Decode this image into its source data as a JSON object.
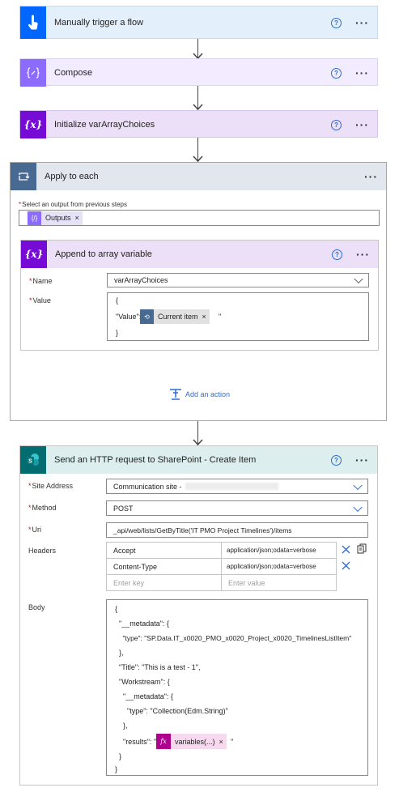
{
  "steps": {
    "trigger": {
      "title": "Manually trigger a flow"
    },
    "compose": {
      "title": "Compose"
    },
    "init_var": {
      "title": "Initialize varArrayChoices",
      "icon_text": "{x}"
    },
    "apply_each": {
      "title": "Apply to each",
      "select_label": "Select an output from previous steps",
      "token": "Outputs",
      "inner": {
        "title": "Append to array variable",
        "icon_text": "{x}",
        "name_label": "Name",
        "name_value": "varArrayChoices",
        "value_label": "Value",
        "value_lines": [
          "{",
          "\"Value\": \"",
          "}"
        ],
        "value_token": "Current item",
        "value_suffix": "\""
      },
      "add_action": "Add an action"
    },
    "http": {
      "title": "Send an HTTP request to SharePoint - Create Item",
      "site_label": "Site Address",
      "site_value": "Communication site -",
      "method_label": "Method",
      "method_value": "POST",
      "uri_label": "Uri",
      "uri_value": "_api/web/lists/GetByTitle('IT PMO Project Timelines')/items",
      "headers_label": "Headers",
      "headers": [
        {
          "key": "Accept",
          "value": "application/json;odata=verbose"
        },
        {
          "key": "Content-Type",
          "value": "application/json;odata=verbose"
        }
      ],
      "key_placeholder": "Enter key",
      "value_placeholder": "Enter value",
      "body_label": "Body",
      "body_lines": [
        "{",
        "  \"__metadata\": {",
        "    \"type\": \"SP.Data.IT_x0020_PMO_x0020_Project_x0020_TimelinesListItem\"",
        "  },",
        "  \"Title\": \"This is a test - 1\",",
        "  \"Workstream\": {",
        "    \"__metadata\": {",
        "      \"type\": \"Collection(Edm.String)\"",
        "    },",
        "    \"results\": \"",
        "  }",
        "}"
      ],
      "body_token": "variables(...)",
      "body_suffix": "\"",
      "fx_text": "fx"
    }
  },
  "common": {
    "help": "?",
    "more": "···",
    "required": "*",
    "remove": "×"
  },
  "colors": {
    "trigger_accent": "#0066ff",
    "trigger_bg": "#e4effc",
    "compose_accent": "#8c6cff",
    "compose_bg": "#f1ecff",
    "variable_accent": "#770bd6",
    "variable_bg": "#ebe0f7",
    "control_accent": "#486991",
    "control_bg": "#e2e7ee",
    "sharepoint_accent": "#036c70",
    "sharepoint_bg": "#dceeee",
    "expression_accent": "#ad008c"
  }
}
